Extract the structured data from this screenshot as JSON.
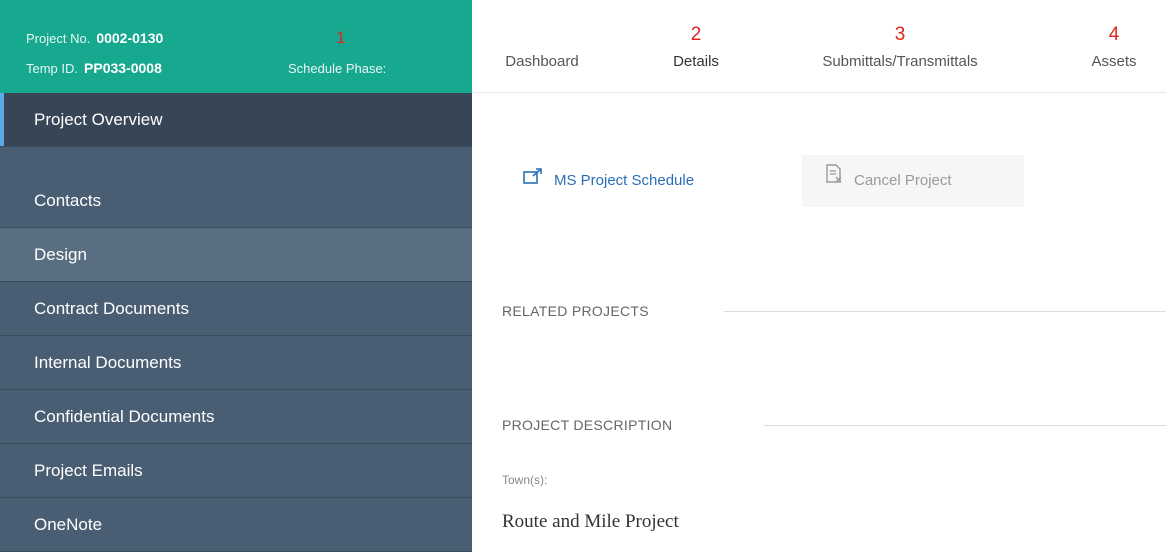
{
  "project": {
    "project_no_label": "Project No.",
    "project_no": "0002-0130",
    "temp_id_label": "Temp ID.",
    "temp_id": "PP033-0008",
    "schedule_phase_label": "Schedule Phase:",
    "annotation": "1"
  },
  "tabs": [
    {
      "number": "",
      "label": "Dashboard",
      "active": false
    },
    {
      "number": "2",
      "label": "Details",
      "active": true
    },
    {
      "number": "3",
      "label": "Submittals/Transmittals",
      "active": false
    },
    {
      "number": "4",
      "label": "Assets",
      "active": false
    }
  ],
  "sidebar": {
    "items": [
      {
        "label": "Project Overview",
        "state": "active"
      },
      {
        "label": "Contacts",
        "state": "normal"
      },
      {
        "label": "Design",
        "state": "hover"
      },
      {
        "label": "Contract Documents",
        "state": "normal"
      },
      {
        "label": "Internal Documents",
        "state": "normal"
      },
      {
        "label": "Confidential Documents",
        "state": "normal"
      },
      {
        "label": "Project Emails",
        "state": "normal"
      },
      {
        "label": "OneNote",
        "state": "normal"
      }
    ]
  },
  "actions": {
    "ms_project_schedule": "MS Project Schedule",
    "cancel_project": "Cancel Project"
  },
  "sections": {
    "related_projects": "RELATED PROJECTS",
    "project_description": "PROJECT DESCRIPTION"
  },
  "fields": {
    "towns_label": "Town(s):",
    "towns_value": "Route and Mile Project"
  },
  "colors": {
    "header_teal": "#17a98f",
    "sidebar": "#4a5e73",
    "sidebar_active": "#364656",
    "annotation_red": "#e0261c",
    "link_blue": "#2a6fb5"
  }
}
